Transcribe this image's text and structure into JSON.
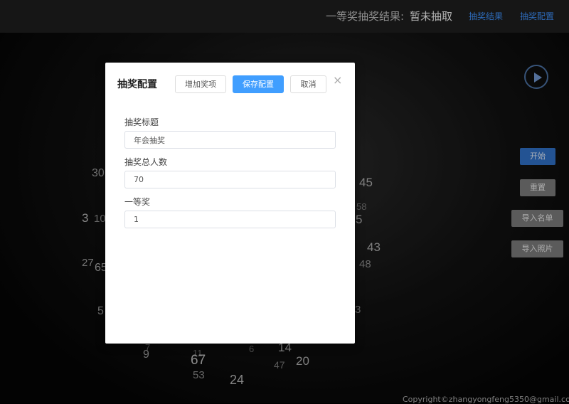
{
  "header": {
    "result_label": "一等奖抽奖结果:",
    "result_value": "暂未抽取",
    "link_results": "抽奖结果",
    "link_config": "抽奖配置"
  },
  "side_buttons": {
    "start": "开始",
    "reset": "重置",
    "import_list": "导入名单",
    "import_photos": "导入照片"
  },
  "background_numbers": [
    "30",
    "3",
    "10",
    "27",
    "65",
    "5",
    "45",
    "58",
    "5",
    "43",
    "48",
    "3",
    "7",
    "9",
    "11",
    "6",
    "14",
    "67",
    "47",
    "20",
    "53",
    "24"
  ],
  "copyright": "Copyright©zhangyongfeng5350@gmail.com",
  "modal": {
    "title": "抽奖配置",
    "add_prize": "增加奖项",
    "save": "保存配置",
    "cancel": "取消",
    "close_glyph": "×",
    "fields": [
      {
        "label": "抽奖标题",
        "value": "年会抽奖"
      },
      {
        "label": "抽奖总人数",
        "value": "70"
      },
      {
        "label": "一等奖",
        "value": "1"
      }
    ]
  },
  "colors": {
    "link": "#3c8df5",
    "primary": "#409eff",
    "start_button": "#2f6fc4",
    "gray_button": "#7a7a7a"
  }
}
